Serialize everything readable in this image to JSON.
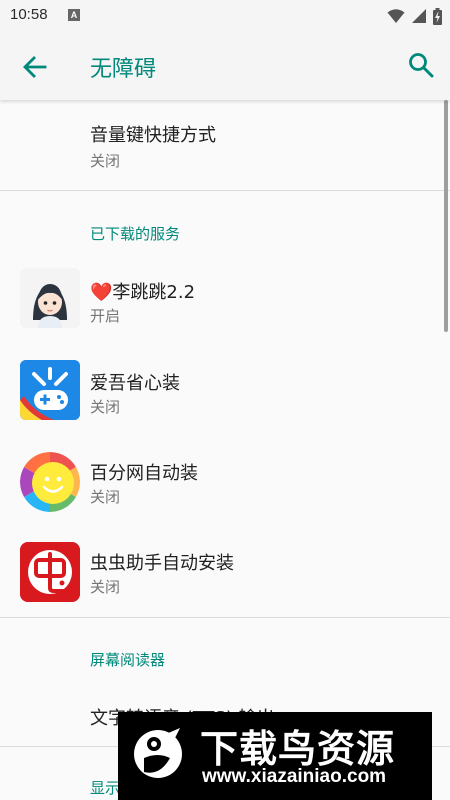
{
  "status_bar": {
    "time": "10:58",
    "notification_letter": "A"
  },
  "app_bar": {
    "title": "无障碍"
  },
  "top_item": {
    "title": "音量键快捷方式",
    "status": "关闭"
  },
  "downloaded_section": {
    "header": "已下载的服务",
    "items": [
      {
        "title_prefix": "❤️",
        "title": "李跳跳2.2",
        "status": "开启",
        "icon": "girl-avatar-icon"
      },
      {
        "title": "爱吾省心装",
        "status": "关闭",
        "icon": "gamepad-icon"
      },
      {
        "title": "百分网自动装",
        "status": "关闭",
        "icon": "smiley-icon"
      },
      {
        "title": "虫虫助手自动安装",
        "status": "关闭",
        "icon": "chongchong-icon"
      }
    ]
  },
  "screen_reader_section": {
    "header": "屏幕阅读器",
    "items": [
      {
        "title": "文字转语音 (TTS) 输出"
      }
    ]
  },
  "display_section": {
    "header": "显示"
  },
  "watermark": {
    "main": "下载鸟资源",
    "url": "www.xiazainiao.com"
  },
  "colors": {
    "accent": "#00897b",
    "background": "#fafafa",
    "chongchong_red": "#d8191e"
  }
}
